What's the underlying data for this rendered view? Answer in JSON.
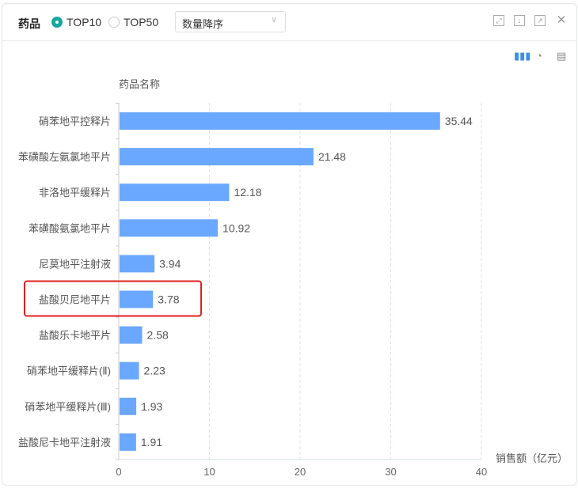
{
  "header": {
    "title": "药品",
    "radio_options": [
      "TOP10",
      "TOP50"
    ],
    "selected": "TOP10",
    "sort_select": "数量降序"
  },
  "colors": {
    "bar": "#6aa8ff",
    "accent": "#13a89e",
    "highlight": "#e02020"
  },
  "chart_data": {
    "type": "bar",
    "orientation": "horizontal",
    "ylabel": "药品名称",
    "xlabel": "销售额（亿元）",
    "categories": [
      "硝苯地平控释片",
      "苯磺酸左氨氯地平片",
      "非洛地平缓释片",
      "苯磺酸氨氯地平片",
      "尼莫地平注射液",
      "盐酸贝尼地平片",
      "盐酸乐卡地平片",
      "硝苯地平缓释片(Ⅱ)",
      "硝苯地平缓释片(Ⅲ)",
      "盐酸尼卡地平注射液"
    ],
    "values": [
      35.44,
      21.48,
      12.18,
      10.92,
      3.94,
      3.78,
      2.58,
      2.23,
      1.93,
      1.91
    ],
    "xlim": [
      0,
      40
    ],
    "xticks": [
      0,
      10,
      20,
      30,
      40
    ],
    "highlighted_category": "盐酸贝尼地平片",
    "grid": "dashed vertical"
  }
}
